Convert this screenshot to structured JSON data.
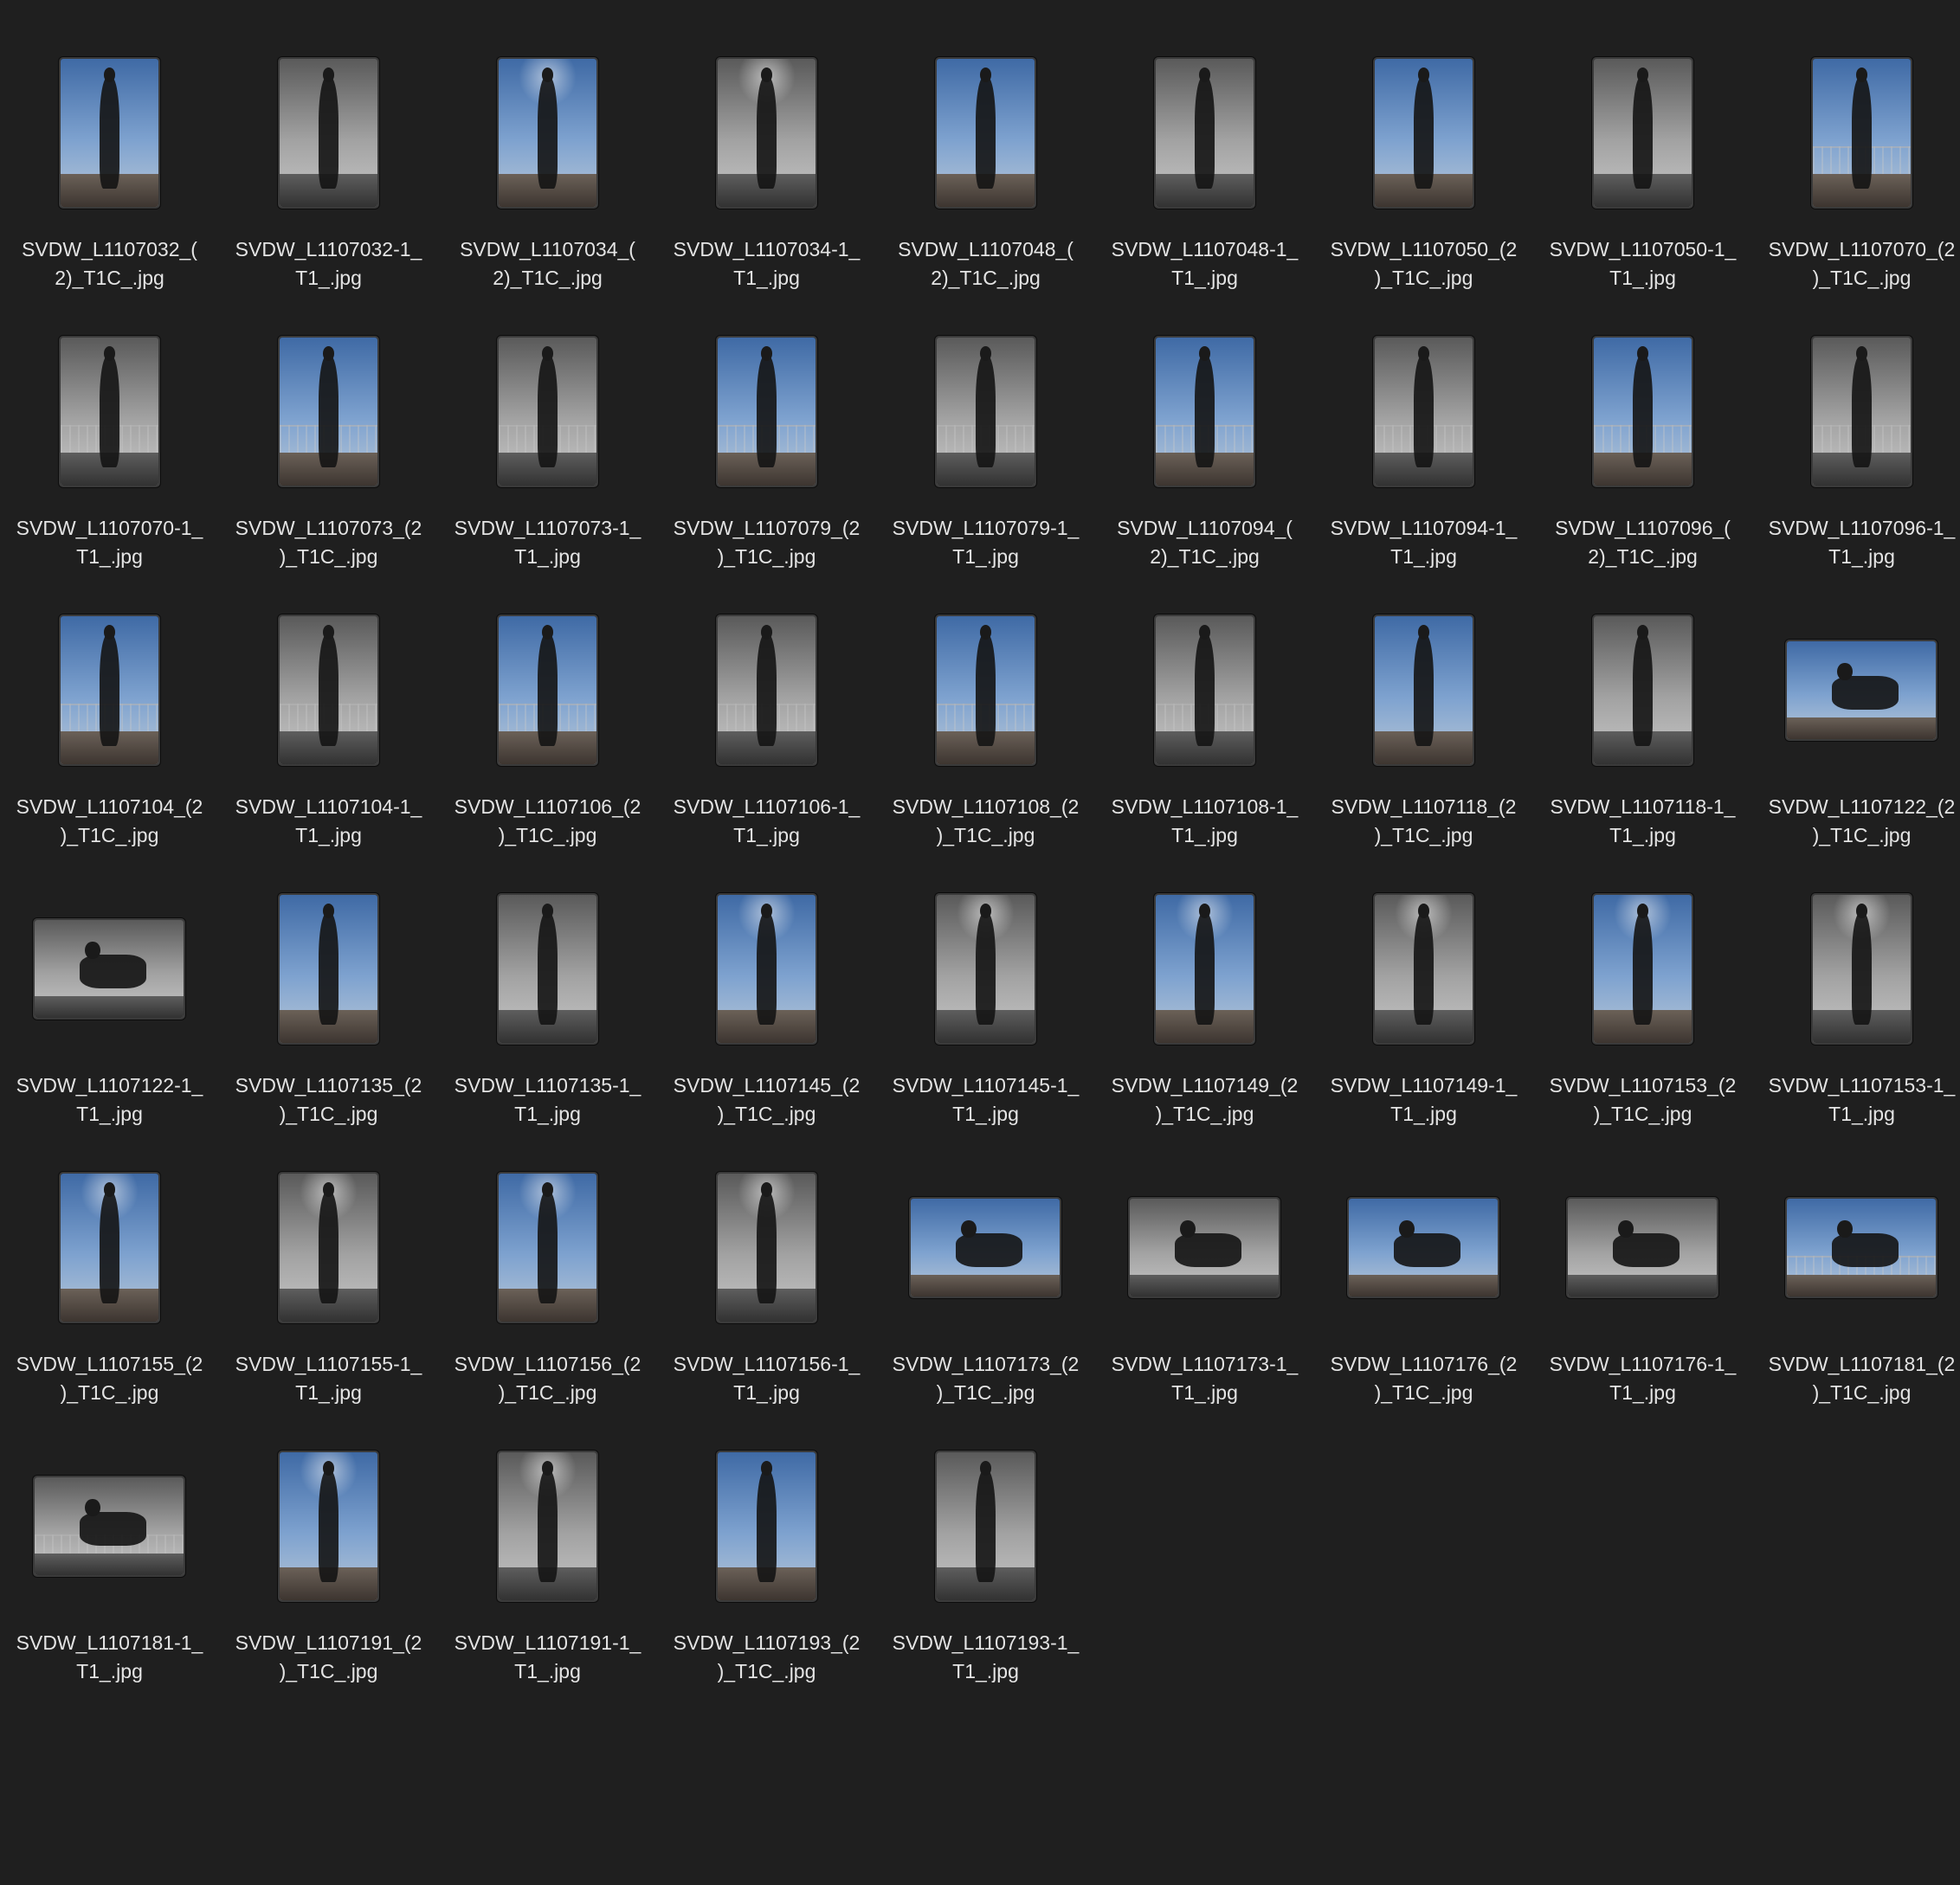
{
  "files": [
    {
      "name": "SVDW_L1107032_(2)_T1C_.jpg",
      "line1": "SVDW_L1107032_(",
      "line2": "2)_T1C_.jpg",
      "orientation": "portrait",
      "tone": "color",
      "scene": "plain"
    },
    {
      "name": "SVDW_L1107032-1_T1_.jpg",
      "line1": "SVDW_L1107032-1_",
      "line2": "T1_.jpg",
      "orientation": "portrait",
      "tone": "bw",
      "scene": "plain"
    },
    {
      "name": "SVDW_L1107034_(2)_T1C_.jpg",
      "line1": "SVDW_L1107034_(",
      "line2": "2)_T1C_.jpg",
      "orientation": "portrait",
      "tone": "color",
      "scene": "sun"
    },
    {
      "name": "SVDW_L1107034-1_T1_.jpg",
      "line1": "SVDW_L1107034-1_",
      "line2": "T1_.jpg",
      "orientation": "portrait",
      "tone": "bw",
      "scene": "sun"
    },
    {
      "name": "SVDW_L1107048_(2)_T1C_.jpg",
      "line1": "SVDW_L1107048_(",
      "line2": "2)_T1C_.jpg",
      "orientation": "portrait",
      "tone": "color",
      "scene": "plain"
    },
    {
      "name": "SVDW_L1107048-1_T1_.jpg",
      "line1": "SVDW_L1107048-1_",
      "line2": "T1_.jpg",
      "orientation": "portrait",
      "tone": "bw",
      "scene": "plain"
    },
    {
      "name": "SVDW_L1107050_(2)_T1C_.jpg",
      "line1": "SVDW_L1107050_(2",
      "line2": ")_T1C_.jpg",
      "orientation": "portrait",
      "tone": "color",
      "scene": "plain"
    },
    {
      "name": "SVDW_L1107050-1_T1_.jpg",
      "line1": "SVDW_L1107050-1_",
      "line2": "T1_.jpg",
      "orientation": "portrait",
      "tone": "bw",
      "scene": "plain"
    },
    {
      "name": "SVDW_L1107070_(2)_T1C_.jpg",
      "line1": "SVDW_L1107070_(2",
      "line2": ")_T1C_.jpg",
      "orientation": "portrait",
      "tone": "color",
      "scene": "rail"
    },
    {
      "name": "SVDW_L1107070-1_T1_.jpg",
      "line1": "SVDW_L1107070-1_",
      "line2": "T1_.jpg",
      "orientation": "portrait",
      "tone": "bw",
      "scene": "rail"
    },
    {
      "name": "SVDW_L1107073_(2)_T1C_.jpg",
      "line1": "SVDW_L1107073_(2",
      "line2": ")_T1C_.jpg",
      "orientation": "portrait",
      "tone": "color",
      "scene": "rail"
    },
    {
      "name": "SVDW_L1107073-1_T1_.jpg",
      "line1": "SVDW_L1107073-1_",
      "line2": "T1_.jpg",
      "orientation": "portrait",
      "tone": "bw",
      "scene": "rail"
    },
    {
      "name": "SVDW_L1107079_(2)_T1C_.jpg",
      "line1": "SVDW_L1107079_(2",
      "line2": ")_T1C_.jpg",
      "orientation": "portrait",
      "tone": "color",
      "scene": "rail"
    },
    {
      "name": "SVDW_L1107079-1_T1_.jpg",
      "line1": "SVDW_L1107079-1_",
      "line2": "T1_.jpg",
      "orientation": "portrait",
      "tone": "bw",
      "scene": "rail"
    },
    {
      "name": "SVDW_L1107094_(2)_T1C_.jpg",
      "line1": "SVDW_L1107094_(",
      "line2": "2)_T1C_.jpg",
      "orientation": "portrait",
      "tone": "color",
      "scene": "rail"
    },
    {
      "name": "SVDW_L1107094-1_T1_.jpg",
      "line1": "SVDW_L1107094-1_",
      "line2": "T1_.jpg",
      "orientation": "portrait",
      "tone": "bw",
      "scene": "rail"
    },
    {
      "name": "SVDW_L1107096_(2)_T1C_.jpg",
      "line1": "SVDW_L1107096_(",
      "line2": "2)_T1C_.jpg",
      "orientation": "portrait",
      "tone": "color",
      "scene": "rail"
    },
    {
      "name": "SVDW_L1107096-1_T1_.jpg",
      "line1": "SVDW_L1107096-1_",
      "line2": "T1_.jpg",
      "orientation": "portrait",
      "tone": "bw",
      "scene": "rail"
    },
    {
      "name": "SVDW_L1107104_(2)_T1C_.jpg",
      "line1": "SVDW_L1107104_(2",
      "line2": ")_T1C_.jpg",
      "orientation": "portrait",
      "tone": "color",
      "scene": "city"
    },
    {
      "name": "SVDW_L1107104-1_T1_.jpg",
      "line1": "SVDW_L1107104-1_",
      "line2": "T1_.jpg",
      "orientation": "portrait",
      "tone": "bw",
      "scene": "city"
    },
    {
      "name": "SVDW_L1107106_(2)_T1C_.jpg",
      "line1": "SVDW_L1107106_(2",
      "line2": ")_T1C_.jpg",
      "orientation": "portrait",
      "tone": "color",
      "scene": "city"
    },
    {
      "name": "SVDW_L1107106-1_T1_.jpg",
      "line1": "SVDW_L1107106-1_",
      "line2": "T1_.jpg",
      "orientation": "portrait",
      "tone": "bw",
      "scene": "city"
    },
    {
      "name": "SVDW_L1107108_(2)_T1C_.jpg",
      "line1": "SVDW_L1107108_(2",
      "line2": ")_T1C_.jpg",
      "orientation": "portrait",
      "tone": "color",
      "scene": "city"
    },
    {
      "name": "SVDW_L1107108-1_T1_.jpg",
      "line1": "SVDW_L1107108-1_",
      "line2": "T1_.jpg",
      "orientation": "portrait",
      "tone": "bw",
      "scene": "city"
    },
    {
      "name": "SVDW_L1107118_(2)_T1C_.jpg",
      "line1": "SVDW_L1107118_(2",
      "line2": ")_T1C_.jpg",
      "orientation": "portrait",
      "tone": "color",
      "scene": "plain"
    },
    {
      "name": "SVDW_L1107118-1_T1_.jpg",
      "line1": "SVDW_L1107118-1_",
      "line2": "T1_.jpg",
      "orientation": "portrait",
      "tone": "bw",
      "scene": "plain"
    },
    {
      "name": "SVDW_L1107122_(2)_T1C_.jpg",
      "line1": "SVDW_L1107122_(2",
      "line2": ")_T1C_.jpg",
      "orientation": "landscape",
      "tone": "color",
      "scene": "plain"
    },
    {
      "name": "SVDW_L1107122-1_T1_.jpg",
      "line1": "SVDW_L1107122-1_",
      "line2": "T1_.jpg",
      "orientation": "landscape",
      "tone": "bw",
      "scene": "plain"
    },
    {
      "name": "SVDW_L1107135_(2)_T1C_.jpg",
      "line1": "SVDW_L1107135_(2",
      "line2": ")_T1C_.jpg",
      "orientation": "portrait",
      "tone": "color",
      "scene": "plain"
    },
    {
      "name": "SVDW_L1107135-1_T1_.jpg",
      "line1": "SVDW_L1107135-1_",
      "line2": "T1_.jpg",
      "orientation": "portrait",
      "tone": "bw",
      "scene": "plain"
    },
    {
      "name": "SVDW_L1107145_(2)_T1C_.jpg",
      "line1": "SVDW_L1107145_(2",
      "line2": ")_T1C_.jpg",
      "orientation": "portrait",
      "tone": "color",
      "scene": "sun"
    },
    {
      "name": "SVDW_L1107145-1_T1_.jpg",
      "line1": "SVDW_L1107145-1_",
      "line2": "T1_.jpg",
      "orientation": "portrait",
      "tone": "bw",
      "scene": "sun"
    },
    {
      "name": "SVDW_L1107149_(2)_T1C_.jpg",
      "line1": "SVDW_L1107149_(2",
      "line2": ")_T1C_.jpg",
      "orientation": "portrait",
      "tone": "color",
      "scene": "sun"
    },
    {
      "name": "SVDW_L1107149-1_T1_.jpg",
      "line1": "SVDW_L1107149-1_",
      "line2": "T1_.jpg",
      "orientation": "portrait",
      "tone": "bw",
      "scene": "sun"
    },
    {
      "name": "SVDW_L1107153_(2)_T1C_.jpg",
      "line1": "SVDW_L1107153_(2",
      "line2": ")_T1C_.jpg",
      "orientation": "portrait",
      "tone": "color",
      "scene": "sun"
    },
    {
      "name": "SVDW_L1107153-1_T1_.jpg",
      "line1": "SVDW_L1107153-1_",
      "line2": "T1_.jpg",
      "orientation": "portrait",
      "tone": "bw",
      "scene": "sun"
    },
    {
      "name": "SVDW_L1107155_(2)_T1C_.jpg",
      "line1": "SVDW_L1107155_(2",
      "line2": ")_T1C_.jpg",
      "orientation": "portrait",
      "tone": "color",
      "scene": "sun"
    },
    {
      "name": "SVDW_L1107155-1_T1_.jpg",
      "line1": "SVDW_L1107155-1_",
      "line2": "T1_.jpg",
      "orientation": "portrait",
      "tone": "bw",
      "scene": "sun"
    },
    {
      "name": "SVDW_L1107156_(2)_T1C_.jpg",
      "line1": "SVDW_L1107156_(2",
      "line2": ")_T1C_.jpg",
      "orientation": "portrait",
      "tone": "color",
      "scene": "sun"
    },
    {
      "name": "SVDW_L1107156-1_T1_.jpg",
      "line1": "SVDW_L1107156-1_",
      "line2": "T1_.jpg",
      "orientation": "portrait",
      "tone": "bw",
      "scene": "sun"
    },
    {
      "name": "SVDW_L1107173_(2)_T1C_.jpg",
      "line1": "SVDW_L1107173_(2",
      "line2": ")_T1C_.jpg",
      "orientation": "landscape",
      "tone": "color",
      "scene": "plain"
    },
    {
      "name": "SVDW_L1107173-1_T1_.jpg",
      "line1": "SVDW_L1107173-1_",
      "line2": "T1_.jpg",
      "orientation": "landscape",
      "tone": "bw",
      "scene": "plain"
    },
    {
      "name": "SVDW_L1107176_(2)_T1C_.jpg",
      "line1": "SVDW_L1107176_(2",
      "line2": ")_T1C_.jpg",
      "orientation": "landscape",
      "tone": "color",
      "scene": "plain"
    },
    {
      "name": "SVDW_L1107176-1_T1_.jpg",
      "line1": "SVDW_L1107176-1_",
      "line2": "T1_.jpg",
      "orientation": "landscape",
      "tone": "bw",
      "scene": "plain"
    },
    {
      "name": "SVDW_L1107181_(2)_T1C_.jpg",
      "line1": "SVDW_L1107181_(2",
      "line2": ")_T1C_.jpg",
      "orientation": "landscape",
      "tone": "color",
      "scene": "city"
    },
    {
      "name": "SVDW_L1107181-1_T1_.jpg",
      "line1": "SVDW_L1107181-1_",
      "line2": "T1_.jpg",
      "orientation": "landscape",
      "tone": "bw",
      "scene": "city"
    },
    {
      "name": "SVDW_L1107191_(2)_T1C_.jpg",
      "line1": "SVDW_L1107191_(2",
      "line2": ")_T1C_.jpg",
      "orientation": "portrait",
      "tone": "color",
      "scene": "sun"
    },
    {
      "name": "SVDW_L1107191-1_T1_.jpg",
      "line1": "SVDW_L1107191-1_",
      "line2": "T1_.jpg",
      "orientation": "portrait",
      "tone": "bw",
      "scene": "sun"
    },
    {
      "name": "SVDW_L1107193_(2)_T1C_.jpg",
      "line1": "SVDW_L1107193_(2",
      "line2": ")_T1C_.jpg",
      "orientation": "portrait",
      "tone": "color",
      "scene": "plain"
    },
    {
      "name": "SVDW_L1107193-1_T1_.jpg",
      "line1": "SVDW_L1107193-1_",
      "line2": "T1_.jpg",
      "orientation": "portrait",
      "tone": "bw",
      "scene": "plain"
    }
  ],
  "colors": {
    "background": "#1f1f1f",
    "label_text": "#e4e4e4"
  }
}
